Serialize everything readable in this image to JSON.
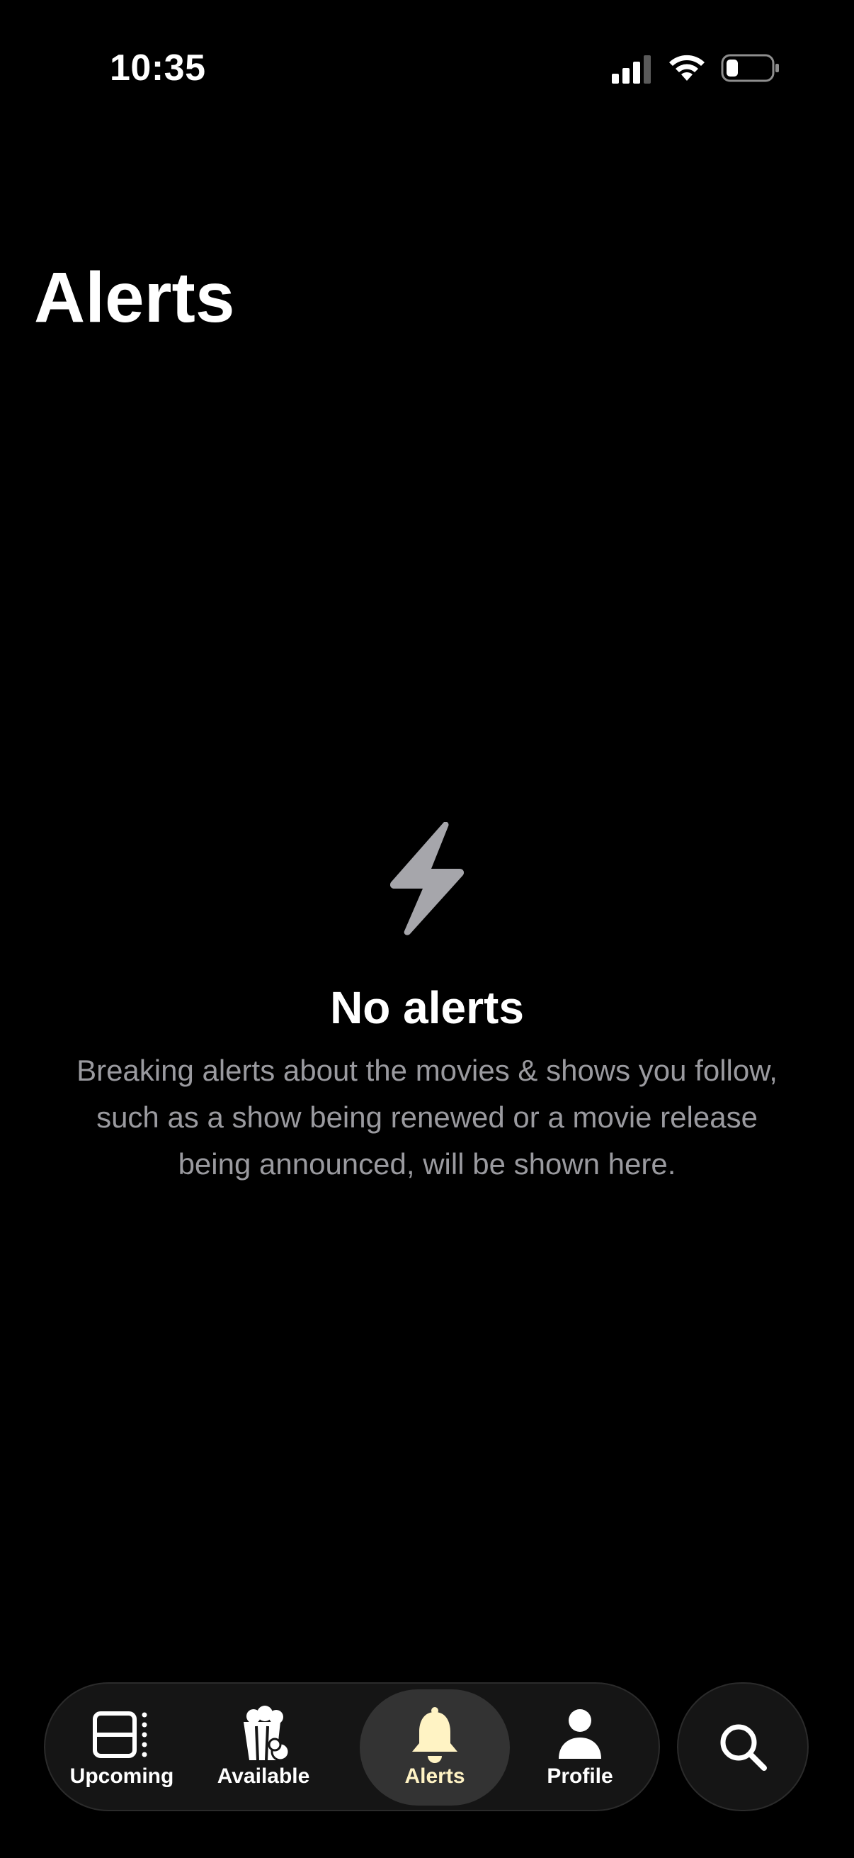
{
  "status_bar": {
    "time": "10:35",
    "icons": [
      "cellular-signal-icon",
      "wifi-icon",
      "battery-icon"
    ]
  },
  "header": {
    "title": "Alerts"
  },
  "empty_state": {
    "icon": "lightning-bolt-icon",
    "title": "No alerts",
    "description": "Breaking alerts about the movies & shows you follow, such as a show being renewed or a movie release being announced, will be shown here."
  },
  "tab_bar": {
    "tabs": [
      {
        "label": "Upcoming",
        "icon": "calendar-list-icon",
        "active": false
      },
      {
        "label": "Available",
        "icon": "popcorn-icon",
        "active": false
      },
      {
        "label": "Alerts",
        "icon": "bell-icon",
        "active": true
      },
      {
        "label": "Profile",
        "icon": "person-icon",
        "active": false
      }
    ],
    "search_icon": "search-icon"
  },
  "colors": {
    "background": "#000000",
    "text_primary": "#ffffff",
    "text_secondary": "#9a9a9f",
    "icon_gray": "#a6a6ab",
    "active_tab_accent": "#fff3c4",
    "tab_bar_bg": "#151515",
    "active_pill_bg": "#333333"
  }
}
